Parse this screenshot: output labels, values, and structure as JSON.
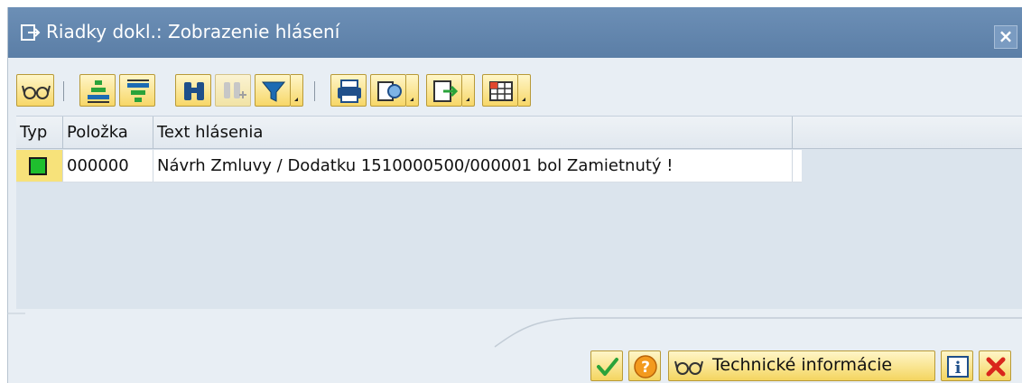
{
  "window": {
    "title": "Riadky dokl.: Zobrazenie hlásení",
    "title_icon": "window-doc-icon",
    "close_icon": "close-icon",
    "close_glyph": "×"
  },
  "toolbar": {
    "buttons": [
      {
        "icon": "glasses-details-icon"
      },
      {
        "icon": "sort-ascending-icon"
      },
      {
        "icon": "sort-descending-icon"
      },
      {
        "icon": "binoculars-find-icon"
      },
      {
        "icon": "find-next-icon",
        "disabled": true
      },
      {
        "icon": "filter-icon",
        "has_dropdown": true
      },
      {
        "icon": "print-icon"
      },
      {
        "icon": "views-icon",
        "has_dropdown": true
      },
      {
        "icon": "export-icon",
        "has_dropdown": true
      },
      {
        "icon": "layout-icon",
        "has_dropdown": true
      }
    ]
  },
  "grid": {
    "columns": [
      "Typ",
      "Položka",
      "Text hlásenia"
    ],
    "rows": [
      {
        "typ_status": "success",
        "typ_color": "#1fbf2e",
        "polozka": "000000",
        "text": "Návrh Zmluvy / Dodatku 1510000500/000001 bol Zamietnutý !"
      }
    ]
  },
  "footer": {
    "confirm_icon": "checkmark-icon",
    "help_icon": "help-icon",
    "technical_label": "Technické informácie",
    "technical_icon": "glasses-icon",
    "info_icon": "info-icon",
    "cancel_icon": "cancel-x-icon"
  },
  "colors": {
    "title_bar": "#5b7ea6",
    "button_yellow": "#f7d768",
    "success_green": "#1fbf2e",
    "cancel_red": "#d9261c"
  }
}
